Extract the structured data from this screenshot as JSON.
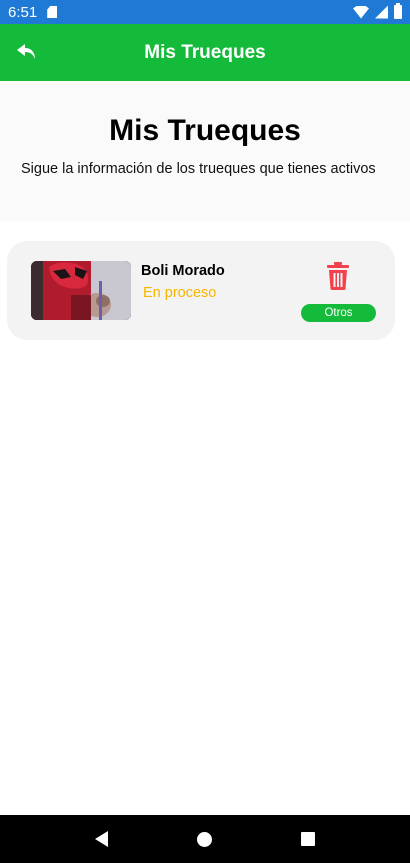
{
  "status_bar": {
    "time": "6:51"
  },
  "app_bar": {
    "title": "Mis Trueques",
    "back_icon": "back-arrow-icon"
  },
  "header": {
    "title": "Mis Trueques",
    "subtitle": "Sigue la información de los trueques que tienes activos"
  },
  "trades": [
    {
      "name": "Boli Morado",
      "status": "En proceso",
      "category": "Otros",
      "delete_icon": "trash-icon"
    }
  ],
  "colors": {
    "primary": "#14bb3a",
    "status_bar": "#1e7ad4",
    "status_pending": "#f7b500",
    "danger": "#f2414b"
  }
}
